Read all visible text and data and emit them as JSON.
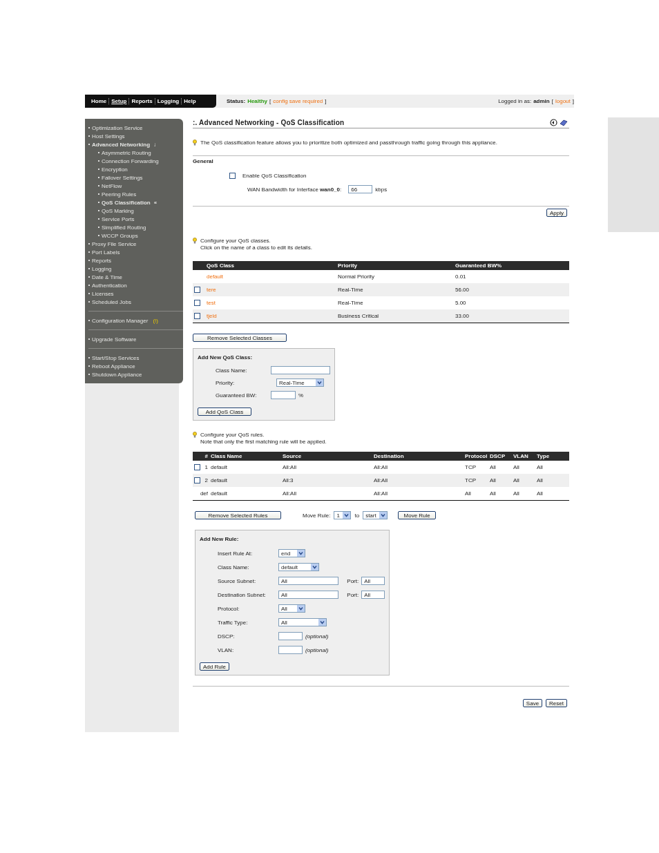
{
  "nav": {
    "items": [
      {
        "label": "Home",
        "selected": false
      },
      {
        "label": "Setup",
        "selected": true
      },
      {
        "label": "Reports",
        "selected": false
      },
      {
        "label": "Logging",
        "selected": false
      },
      {
        "label": "Help",
        "selected": false
      }
    ]
  },
  "status": {
    "label": "Status:",
    "value": "Healthy",
    "open": "[",
    "link": "config save required",
    "close": "]"
  },
  "login": {
    "label": "Logged in as:",
    "user": "admin",
    "open": "[",
    "link": "logout",
    "close": "]"
  },
  "sidebar": {
    "groups": [
      {
        "items": [
          {
            "label": "Optimization Service",
            "selected": false
          },
          {
            "label": "Host Settings",
            "selected": false
          },
          {
            "label": "Advanced Networking",
            "selected": true,
            "expanded": true,
            "mark": "↓",
            "children": [
              {
                "label": "Asymmetric Routing",
                "selected": false
              },
              {
                "label": "Connection Forwarding",
                "selected": false
              },
              {
                "label": "Encryption",
                "selected": false
              },
              {
                "label": "Failover Settings",
                "selected": false
              },
              {
                "label": "NetFlow",
                "selected": false
              },
              {
                "label": "Peering Rules",
                "selected": false
              },
              {
                "label": "QoS Classification",
                "selected": true,
                "mark": "«"
              },
              {
                "label": "QoS Marking",
                "selected": false
              },
              {
                "label": "Service Ports",
                "selected": false
              },
              {
                "label": "Simplified Routing",
                "selected": false
              },
              {
                "label": "WCCP Groups",
                "selected": false
              }
            ]
          },
          {
            "label": "Proxy File Service",
            "selected": false
          },
          {
            "label": "Port Labels",
            "selected": false
          },
          {
            "label": "Reports",
            "selected": false
          },
          {
            "label": "Logging",
            "selected": false
          },
          {
            "label": "Date & Time",
            "selected": false
          },
          {
            "label": "Authentication",
            "selected": false
          },
          {
            "label": "Licenses",
            "selected": false
          },
          {
            "label": "Scheduled Jobs",
            "selected": false
          }
        ]
      },
      {
        "items": [
          {
            "label": "Configuration Manager",
            "selected": false,
            "alert": "(!)"
          }
        ]
      },
      {
        "items": [
          {
            "label": "Upgrade Software",
            "selected": false
          }
        ]
      },
      {
        "items": [
          {
            "label": "Start/Stop Services",
            "selected": false
          },
          {
            "label": "Reboot Appliance",
            "selected": false
          },
          {
            "label": "Shutdown Appliance",
            "selected": false
          }
        ]
      }
    ]
  },
  "page": {
    "title": ":. Advanced Networking - QoS Classification",
    "tip": "The QoS classification feature allows you to prioritize both optimized and passthrough traffic going through this appliance."
  },
  "general": {
    "heading": "General",
    "enable": {
      "label": "Enable QoS Classification",
      "checked": false
    },
    "bandwidth": {
      "label": "WAN Bandwidth for Interface **wan0_0**:",
      "value": "66",
      "unit": "kbps"
    },
    "apply": "Apply"
  },
  "classes": {
    "tip": [
      "Configure your QoS classes.",
      "Click on the name of a class to edit its details."
    ],
    "columns": [
      "QoS Class",
      "Priority",
      "Guaranteed BW%"
    ],
    "rows": [
      {
        "kind": "fixed",
        "cells": [
          "default",
          "Normal Priority",
          "0.01"
        ]
      },
      {
        "kind": "removable",
        "checked": false,
        "cells": [
          "tere",
          "Real-Time",
          "56.00"
        ]
      },
      {
        "kind": "removable",
        "checked": false,
        "cells": [
          "test",
          "Real-Time",
          "5.00"
        ]
      },
      {
        "kind": "removable",
        "checked": false,
        "cells": [
          "tjeld",
          "Business Critical",
          "33.00"
        ]
      }
    ],
    "remove": "Remove Selected Classes",
    "add": {
      "heading": "Add New QoS Class:",
      "fields": [
        {
          "kind": "text",
          "label": "Class Name:"
        },
        {
          "kind": "select",
          "label": "Priority:",
          "value": "Real-Time"
        },
        {
          "kind": "percent",
          "label": "Guaranteed BW:",
          "unit": "%"
        }
      ],
      "button": "Add QoS Class"
    }
  },
  "rules": {
    "tip": [
      "Configure your QoS rules.",
      "Note that only the first matching rule will be applied."
    ],
    "columns": [
      "#",
      "Class Name",
      "Source",
      "Destination",
      "Protocol",
      "DSCP",
      "VLAN",
      "Type"
    ],
    "rows": [
      {
        "kind": "removable",
        "checked": false,
        "cells": [
          "1",
          "default",
          "All:All",
          "All:All",
          "TCP",
          "All",
          "All",
          "All"
        ]
      },
      {
        "kind": "removable",
        "checked": false,
        "cells": [
          "2",
          "default",
          "All:3",
          "All:All",
          "TCP",
          "All",
          "All",
          "All"
        ]
      },
      {
        "kind": "fixed",
        "cells": [
          "def",
          "default",
          "All:All",
          "All:All",
          "All",
          "All",
          "All",
          "All"
        ]
      }
    ],
    "remove": "Remove Selected Rules",
    "move": {
      "label": "Move Rule:",
      "from": "1",
      "to_label": "to",
      "to": "start",
      "button": "Move Rule"
    },
    "add": {
      "heading": "Add New Rule:",
      "fields": [
        {
          "kind": "select",
          "label": "Insert Rule At:",
          "value": "end"
        },
        {
          "kind": "select",
          "label": "Class Name:",
          "value": "default"
        },
        {
          "kind": "subnet",
          "label": "Source Subnet:",
          "value": "All",
          "port_label": "Port:",
          "port_value": "All"
        },
        {
          "kind": "subnet",
          "label": "Destination Subnet:",
          "value": "All",
          "port_label": "Port:",
          "port_value": "All"
        },
        {
          "kind": "select",
          "label": "Protocol:",
          "value": "All"
        },
        {
          "kind": "wideselect",
          "label": "Traffic Type:",
          "value": "All"
        },
        {
          "kind": "optional",
          "label": "DSCP:",
          "note": "(optional)"
        },
        {
          "kind": "optional",
          "label": "VLAN:",
          "note": "(optional)"
        }
      ],
      "button": "Add Rule"
    }
  },
  "footer": {
    "buttons": [
      "Save",
      "Reset"
    ]
  }
}
